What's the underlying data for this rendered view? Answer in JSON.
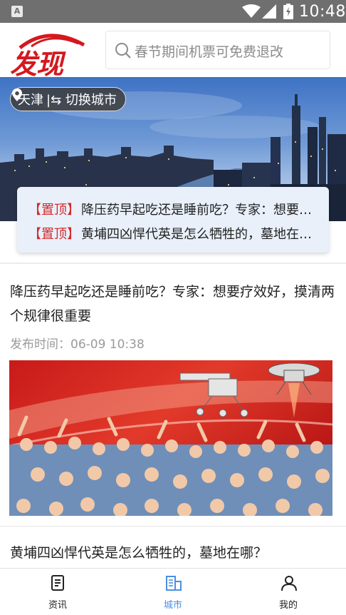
{
  "status_bar": {
    "time": "10:48",
    "app_icon_letter": "A"
  },
  "header": {
    "logo_text": "发现",
    "search_placeholder": "春节期间机票可免费退改"
  },
  "banner": {
    "city": "天津",
    "switch_label": "|⇆ 切换城市"
  },
  "pinned": [
    {
      "tag": "【置顶】",
      "title": "降压药早起吃还是睡前吃？专家：想要疗效好，摸清两个规律很重要"
    },
    {
      "tag": "【置顶】",
      "title": "黄埔四凶悍代英是怎么牺牲的，墓地在哪？"
    }
  ],
  "articles": [
    {
      "title": "降压药早起吃还是睡前吃？专家：想要疗效好，摸清两个规律很重要",
      "time_label": "发布时间：06-09 10:38"
    },
    {
      "title": "黄埔四凶悍代英是怎么牺牲的，墓地在哪？"
    }
  ],
  "bottom_nav": [
    {
      "label": "资讯",
      "icon": "news-icon",
      "active": false
    },
    {
      "label": "城市",
      "icon": "city-icon",
      "active": true
    },
    {
      "label": "我的",
      "icon": "profile-icon",
      "active": false
    }
  ],
  "colors": {
    "accent": "#4a8fe0",
    "brand_red": "#d4181f",
    "tag_red": "#d42a2a"
  }
}
